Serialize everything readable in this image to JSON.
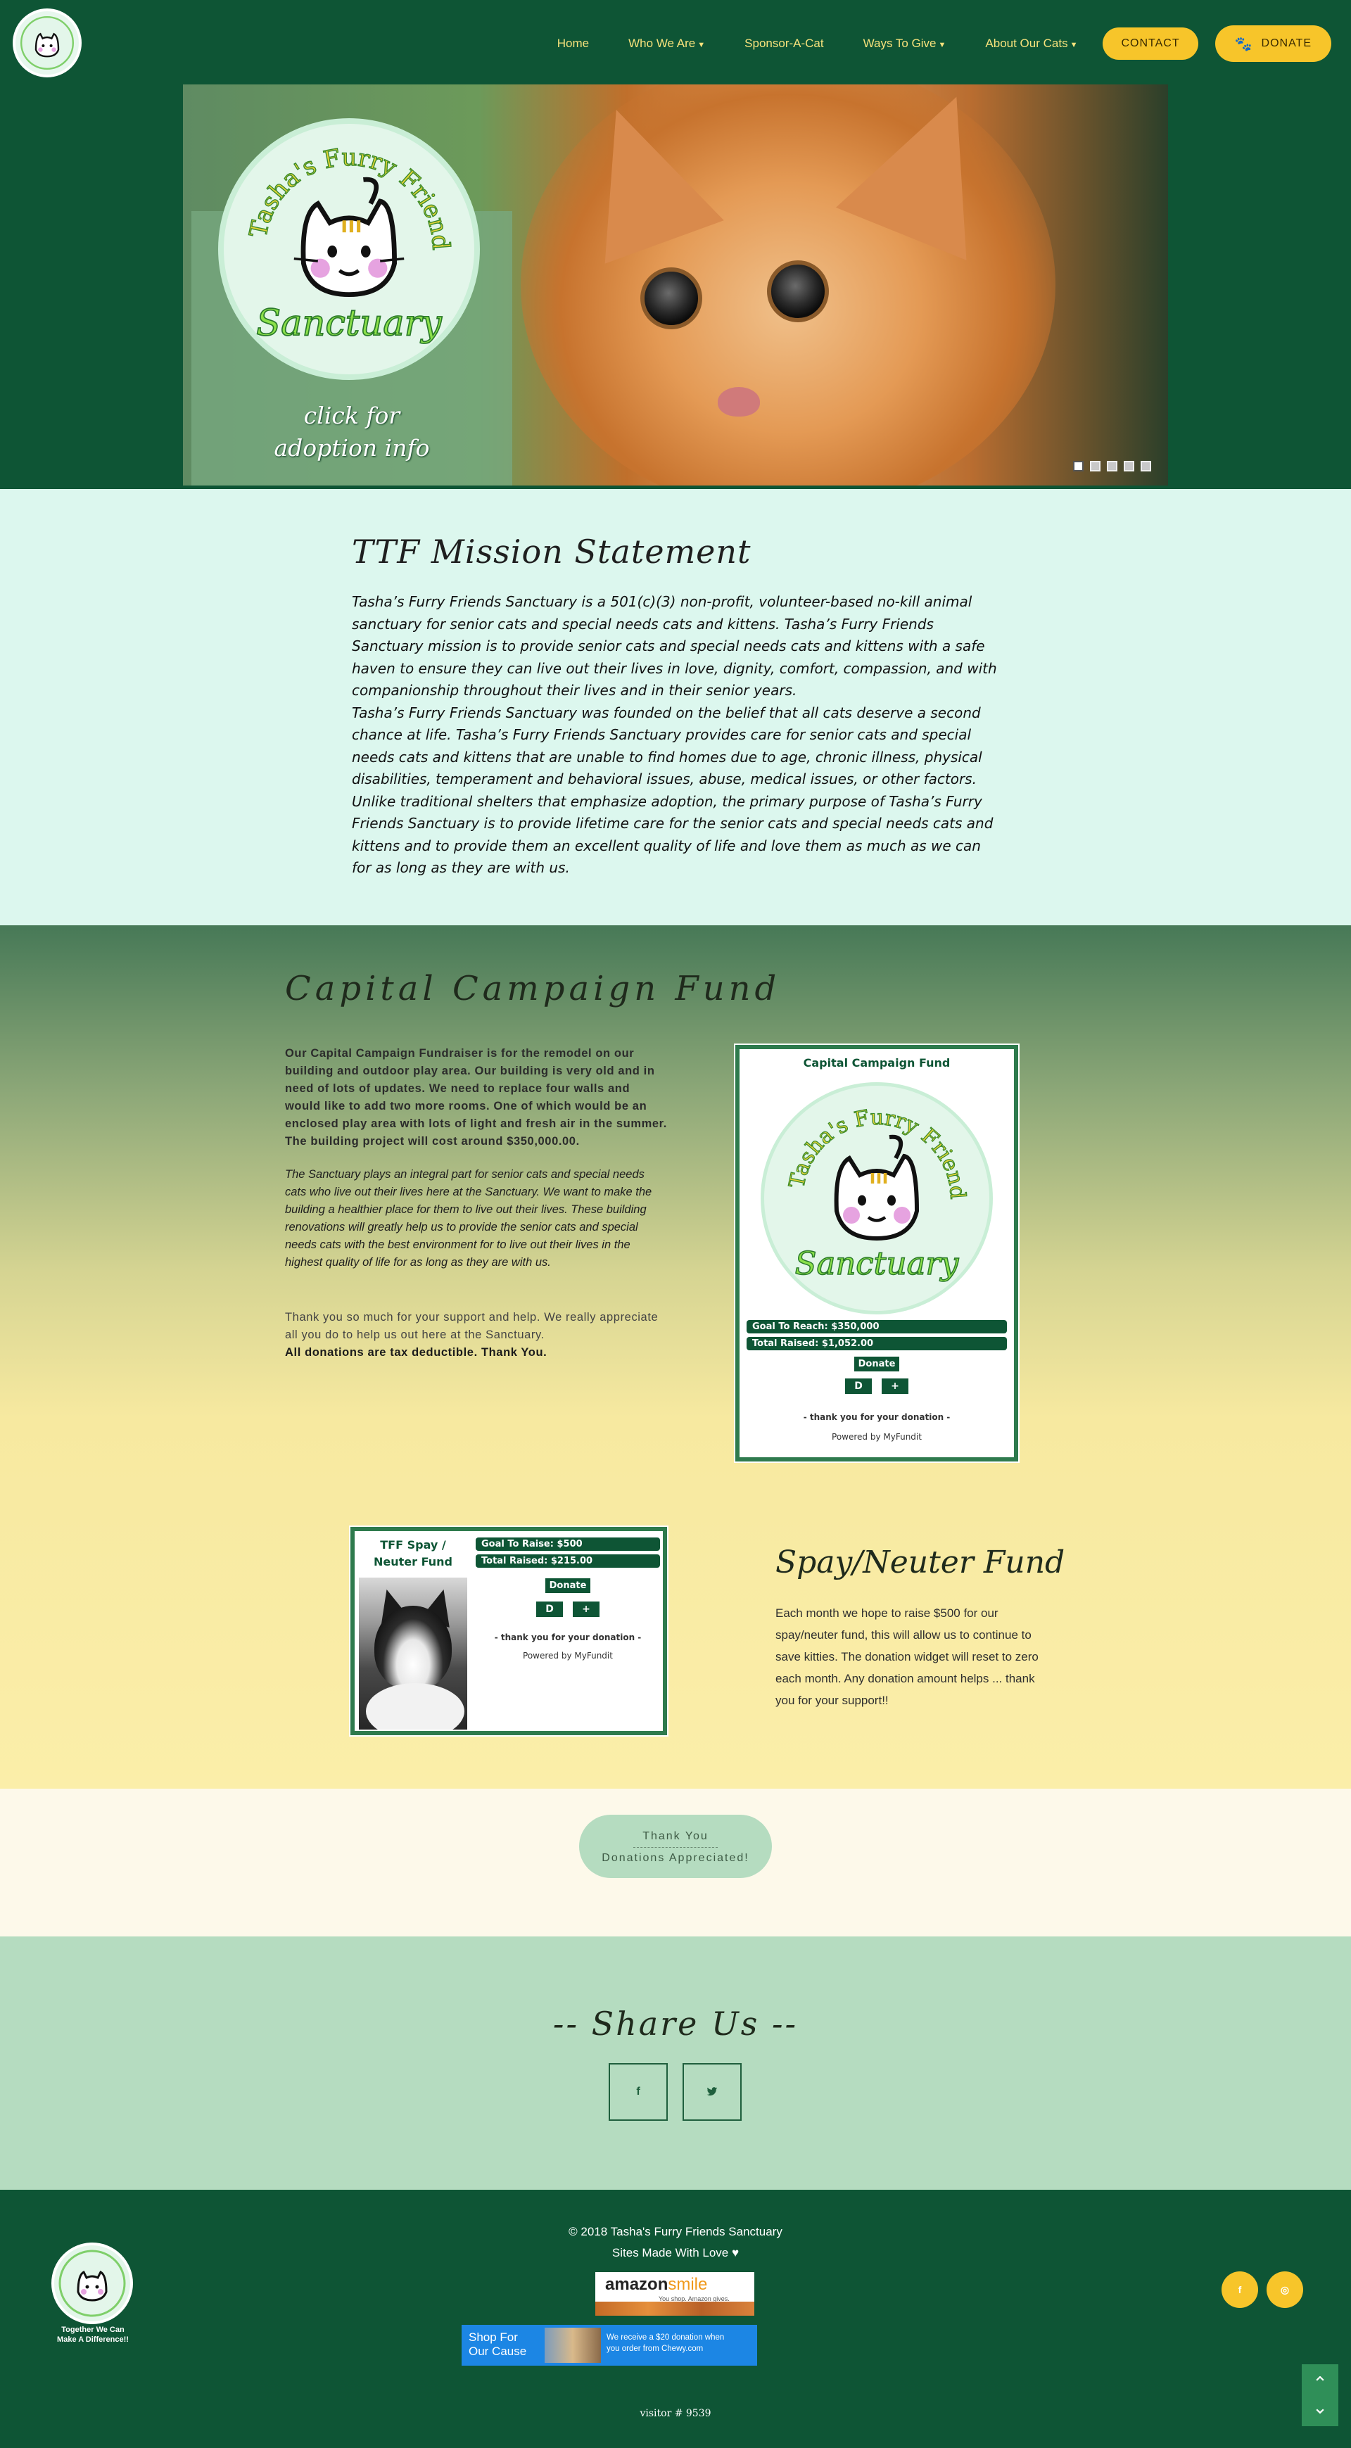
{
  "nav": {
    "items": [
      {
        "label": "Home",
        "caret": false
      },
      {
        "label": "Who We Are",
        "caret": true
      },
      {
        "label": "Sponsor-A-Cat",
        "caret": false
      },
      {
        "label": "Ways To Give",
        "caret": true
      },
      {
        "label": "About Our Cats",
        "caret": true
      }
    ],
    "contact_label": "CONTACT",
    "donate_label": "DONATE"
  },
  "hero": {
    "cta_line1": "click for",
    "cta_line2": "adoption info",
    "slides": 5,
    "active_slide": 1
  },
  "logo": {
    "top_text": "Tasha's Furry Friends",
    "bottom_text": "Sanctuary"
  },
  "mission": {
    "title": "TTF Mission Statement",
    "paragraphs": [
      "Tasha’s Furry Friends Sanctuary is a 501(c)(3) non-profit, volunteer-based no-kill animal sanctuary for senior cats and special needs cats and kittens. Tasha’s Furry Friends Sanctuary mission is to provide senior cats and special needs cats and kittens with a safe haven to ensure they can live out their lives in love, dignity, comfort, compassion, and with companionship throughout their lives and in their senior years.",
      "Tasha’s Furry Friends Sanctuary was founded on the belief that all cats deserve a second chance at life. Tasha’s Furry Friends Sanctuary provides care for senior cats and special needs cats and kittens that are unable to find homes due to age, chronic illness, physical disabilities, temperament and behavioral issues, abuse, medical issues, or other factors.",
      "Unlike traditional shelters that emphasize adoption, the primary purpose of Tasha’s Furry Friends Sanctuary is to provide lifetime care for the senior cats and special needs cats and kittens and to provide them an excellent quality of life and love them as much as we can for as long as they are with us."
    ]
  },
  "capital": {
    "title": "Capital Campaign Fund",
    "p1": "Our Capital Campaign Fundraiser is for the remodel on our building and outdoor play area. Our building is very old and in need of lots of updates. We need to replace four walls and would like to add two more rooms. One of which would be an enclosed play area with lots of light and fresh air in the summer. The building project will cost around $350,000.00.",
    "p2": "The Sanctuary plays an integral part for senior cats and special needs cats who live out their lives here at the Sanctuary. We want to make the building a healthier place for them to live out their lives. These building renovations will greatly help us to provide the senior cats and special needs cats with the best environment for to live out their lives in the highest quality of life for as long as they are with us.",
    "p3": "Thank you so much for your support and help. We really appreciate all you do to help us out here at the Sanctuary.",
    "p3_bold": "All donations are tax deductible. Thank You.",
    "widget": {
      "title": "Capital Campaign Fund",
      "goal": "Goal To Reach:  $350,000",
      "raised": "Total Raised:  $1,052.00",
      "donate_label": "Donate",
      "minus_label": "D",
      "plus_label": "+",
      "thanks": "- thank you for your donation -",
      "powered": "Powered by MyFundit"
    }
  },
  "spay": {
    "title": "Spay/Neuter Fund",
    "text": "Each month we hope to raise $500 for our spay/neuter fund, this will allow us to continue to save kitties. The donation widget will reset to zero each month. Any donation amount helps ... thank you for your support!!",
    "widget": {
      "title": "TFF Spay / Neuter Fund",
      "goal": "Goal To Raise: $500",
      "raised": "Total Raised: $215.00",
      "donate_label": "Donate",
      "minus_label": "D",
      "plus_label": "+",
      "thanks": "- thank you for your donation -",
      "powered": "Powered by MyFundit"
    }
  },
  "thanks_button": {
    "line1": "Thank You",
    "line2": "Donations Appreciated!"
  },
  "share": {
    "title": "-- Share Us --",
    "facebook_label": "f",
    "twitter_label": "❦"
  },
  "footer": {
    "copyright": "© 2018 Tasha's Furry Friends Sanctuary",
    "made_with": "Sites Made With Love ♥",
    "tagline_line1": "Together We Can",
    "tagline_line2": "Make A Difference!!",
    "amazon_word": "amazon",
    "amazon_smile": "smile",
    "amazon_sub": "You shop. Amazon gives.",
    "chewy_line1": "Shop For",
    "chewy_line2": "Our Cause",
    "chewy_text1": "We receive a $20 donation when",
    "chewy_text2": "you order from Chewy.com",
    "visitor": "visitor # 9539",
    "social_facebook": "f",
    "social_instagram": "◎",
    "scroll_up": "⌃",
    "scroll_down": "⌄"
  },
  "colors": {
    "brand_green": "#0e5535",
    "accent_yellow": "#f7c52a",
    "mint": "#dcf7ee",
    "sage": "#b5dcc0"
  }
}
